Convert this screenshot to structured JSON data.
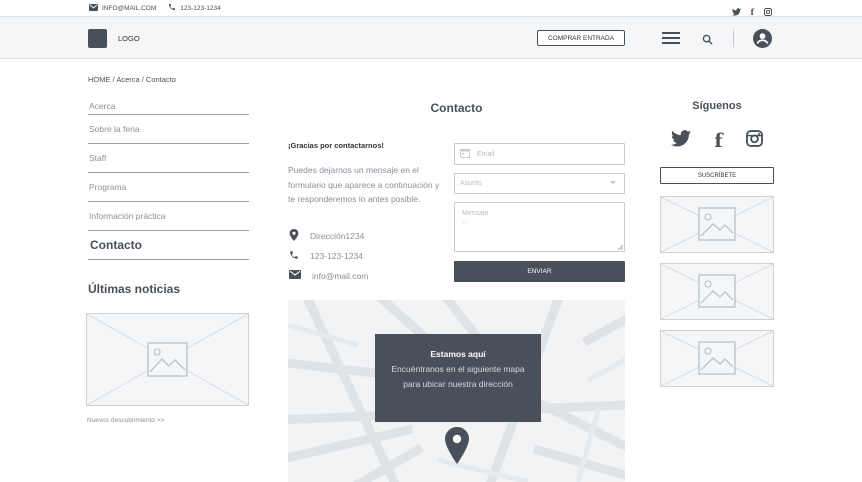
{
  "topbar": {
    "email": "INFO@MAIL.COM",
    "phone": "123-123-1234",
    "social_icons": [
      "twitter-icon",
      "facebook-icon",
      "instagram-icon"
    ]
  },
  "header": {
    "logo_text": "LOGO",
    "buy_button": "COMPRAR ENTRADA"
  },
  "breadcrumb": "HOME /  Acerca / Contacto",
  "sidenav": {
    "items": [
      {
        "label": "Acerca"
      },
      {
        "label": "Sobre la feria"
      },
      {
        "label": "Staff"
      },
      {
        "label": "Programa"
      },
      {
        "label": "Información práctica"
      },
      {
        "label": "Contacto",
        "active": true
      }
    ]
  },
  "news": {
    "title": "Últimas noticias",
    "link": "Nuevos descubrimiento >>"
  },
  "contact": {
    "title": "Contacto",
    "thanks": "¡Gracias por contactarnos!",
    "message": "Puedes dejarnos un mensaje en el formulario que aparece a continuación y te responderemos lo antes posible.",
    "address": "Dirección1234",
    "phone": "123-123-1234",
    "email": "info@mail.com"
  },
  "form": {
    "email_placeholder": "Email",
    "subject_placeholder": "Asunto",
    "message_placeholder": "Mensaje",
    "message_dots": "--",
    "send_button": "ENVIAR"
  },
  "map": {
    "title": "Estamos aquí",
    "description": "Encuéntranos en el siguiente mapa para ubicar nuestra dirección"
  },
  "follow": {
    "title": "Síguenos",
    "subscribe_button": "SUSCRÍBETE"
  },
  "colors": {
    "primary": "#4a505a",
    "header_bg": "#f4f6f8",
    "muted_text": "#8a9099",
    "placeholder_bg": "#f4f6f8"
  }
}
